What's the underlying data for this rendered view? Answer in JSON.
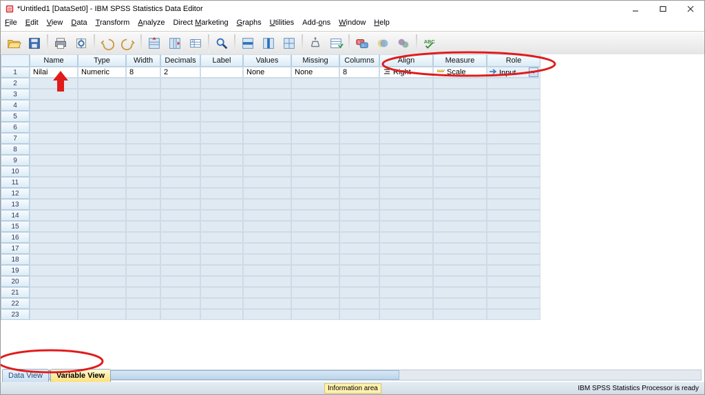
{
  "title": "*Untitled1 [DataSet0] - IBM SPSS Statistics Data Editor",
  "menus": [
    "File",
    "Edit",
    "View",
    "Data",
    "Transform",
    "Analyze",
    "Direct Marketing",
    "Graphs",
    "Utilities",
    "Add-ons",
    "Window",
    "Help"
  ],
  "columns": [
    "Name",
    "Type",
    "Width",
    "Decimals",
    "Label",
    "Values",
    "Missing",
    "Columns",
    "Align",
    "Measure",
    "Role"
  ],
  "row1": {
    "name": "Nilai",
    "type": "Numeric",
    "width": "8",
    "decimals": "2",
    "label": "",
    "values": "None",
    "missing": "None",
    "columns": "8",
    "align": "Right",
    "measure": "Scale",
    "role": "Input"
  },
  "row_count": 23,
  "tabs": {
    "data": "Data View",
    "variable": "Variable View"
  },
  "status": {
    "info": "Information area",
    "processor": "IBM SPSS Statistics Processor is ready"
  },
  "toolbar_icons": [
    "open",
    "save",
    "print",
    "recent",
    "undo",
    "redo",
    "goto-case",
    "goto-var",
    "variables",
    "find",
    "insert-case",
    "insert-var",
    "split",
    "weight",
    "select",
    "value-labels",
    "sets1",
    "sets2",
    "spellcheck"
  ]
}
